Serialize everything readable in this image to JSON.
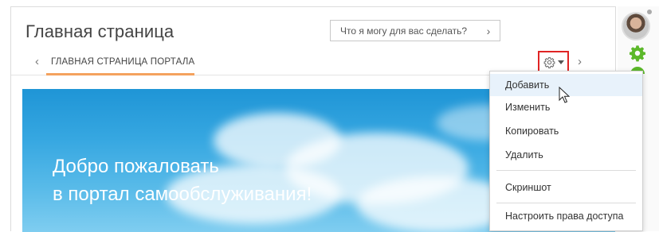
{
  "page": {
    "title": "Главная страница"
  },
  "search": {
    "placeholder": "Что я могу для вас сделать?",
    "arrow": "›"
  },
  "tabs": {
    "back": "‹",
    "current": "ГЛАВНАЯ СТРАНИЦА ПОРТАЛА",
    "next": "›"
  },
  "banner": {
    "line1": "Добро пожаловать",
    "line2": "в портал самообслуживания!"
  },
  "settings_menu": {
    "items": [
      {
        "label": "Добавить"
      },
      {
        "label": "Изменить"
      },
      {
        "label": "Копировать"
      },
      {
        "label": "Удалить"
      },
      {
        "label": "Скриншот"
      },
      {
        "label": "Настроить права доступа"
      }
    ],
    "hovered": "Добавить"
  },
  "colors": {
    "accent": "#f4a25e",
    "highlight": "#e02424",
    "rail_icon": "#5cb82a",
    "banner_sky": "#36a7e1"
  },
  "icons": {
    "settings": "gear-icon",
    "rail_settings": "gear-icon",
    "back": "chevron-left-icon",
    "next": "chevron-right-icon"
  }
}
